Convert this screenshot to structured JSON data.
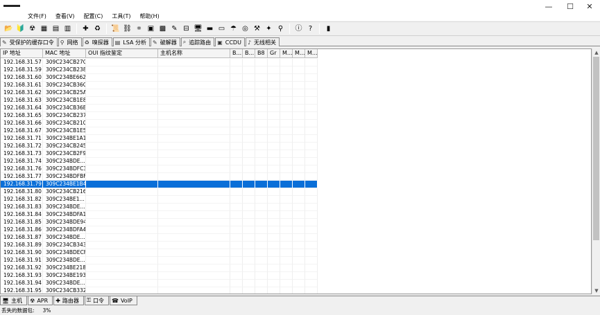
{
  "window": {
    "minimize": "—",
    "maximize": "☐",
    "close": "✕"
  },
  "menu": [
    "文件(F)",
    "查看(V)",
    "配置(C)",
    "工具(T)",
    "帮助(H)"
  ],
  "toolbar": {
    "groups": [
      [
        {
          "name": "open-icon",
          "glyph": "📂"
        },
        {
          "name": "sniffer-start-icon",
          "glyph": "🔰"
        },
        {
          "name": "radiation-icon",
          "glyph": "☢"
        },
        {
          "name": "scan-icon",
          "glyph": "▦"
        },
        {
          "name": "report-icon",
          "glyph": "▤"
        },
        {
          "name": "export-icon",
          "glyph": "▥"
        }
      ],
      [
        {
          "name": "add-icon",
          "glyph": "✚"
        },
        {
          "name": "recycle-icon",
          "glyph": "♻"
        }
      ],
      [
        {
          "name": "certificate-icon",
          "glyph": "📜"
        },
        {
          "name": "route-icon",
          "glyph": "⛓"
        },
        {
          "name": "hash-icon",
          "glyph": "⌗"
        },
        {
          "name": "terminal-green-icon",
          "glyph": "▣"
        },
        {
          "name": "matrix-icon",
          "glyph": "▩"
        },
        {
          "name": "torch-icon",
          "glyph": "✎"
        },
        {
          "name": "database-icon",
          "glyph": "⊟"
        },
        {
          "name": "monitor-icon",
          "glyph": "🖥"
        },
        {
          "name": "card-icon",
          "glyph": "▬"
        },
        {
          "name": "calculator-icon",
          "glyph": "▭"
        },
        {
          "name": "user-tool-icon",
          "glyph": "☂"
        },
        {
          "name": "ball-icon",
          "glyph": "◎"
        },
        {
          "name": "tools-icon",
          "glyph": "⚒"
        },
        {
          "name": "key-icon",
          "glyph": "✦"
        },
        {
          "name": "wand-icon",
          "glyph": "⚲"
        }
      ],
      [
        {
          "name": "info-icon",
          "glyph": "ⓘ"
        },
        {
          "name": "help-icon",
          "glyph": "?"
        }
      ],
      [
        {
          "name": "exit-icon",
          "glyph": "▮"
        }
      ]
    ]
  },
  "top_tabs": [
    {
      "label": "受保护的缓存口令",
      "icon": "shield-icon",
      "glyph": "✎"
    },
    {
      "label": "网络",
      "icon": "network-icon",
      "glyph": "⚲"
    },
    {
      "label": "嗅探器",
      "icon": "sniffer-icon",
      "glyph": "♻"
    },
    {
      "label": "LSA 分析",
      "icon": "lsa-icon",
      "glyph": "▤"
    },
    {
      "label": "破解器",
      "icon": "cracker-icon",
      "glyph": "✎"
    },
    {
      "label": "追踪路由",
      "icon": "traceroute-icon",
      "glyph": "⌕"
    },
    {
      "label": "CCDU",
      "icon": "ccdu-icon",
      "glyph": "▣"
    },
    {
      "label": "无线相关",
      "icon": "wireless-icon",
      "glyph": "♪"
    }
  ],
  "columns": [
    "IP 地址",
    "MAC 地址",
    "OUI 指纹鉴定",
    "主机名称",
    "B...",
    "B...",
    "B8",
    "Gr",
    "M...",
    "M...",
    "M..."
  ],
  "rows": [
    [
      "192.168.31.57",
      "309C234CB27C"
    ],
    [
      "192.168.31.59",
      "309C234CB238"
    ],
    [
      "192.168.31.60",
      "309C234BE662"
    ],
    [
      "192.168.31.61",
      "309C234CB36C"
    ],
    [
      "192.168.31.62",
      "309C234CB25A"
    ],
    [
      "192.168.31.63",
      "309C234CB1E8"
    ],
    [
      "192.168.31.64",
      "309C234CB36B"
    ],
    [
      "192.168.31.65",
      "309C234CB237"
    ],
    [
      "192.168.31.66",
      "309C234CB210"
    ],
    [
      "192.168.31.67",
      "309C234CB1E5"
    ],
    [
      "192.168.31.71",
      "309C234BE1A1"
    ],
    [
      "192.168.31.72",
      "309C234CB245"
    ],
    [
      "192.168.31.73",
      "309C234CB2F9"
    ],
    [
      "192.168.31.74",
      "309C234BDE..."
    ],
    [
      "192.168.31.76",
      "309C234BDFC3"
    ],
    [
      "192.168.31.77",
      "309C234BDFBF"
    ],
    [
      "192.168.31.79",
      "309C234BE1B4"
    ],
    [
      "192.168.31.80",
      "309C234CB216"
    ],
    [
      "192.168.31.82",
      "309C234BE1..."
    ],
    [
      "192.168.31.83",
      "309C234BDE..."
    ],
    [
      "192.168.31.84",
      "309C234BDFA1"
    ],
    [
      "192.168.31.85",
      "309C234BDE94"
    ],
    [
      "192.168.31.86",
      "309C234BDFA4"
    ],
    [
      "192.168.31.87",
      "309C234BDE..."
    ],
    [
      "192.168.31.89",
      "309C234CB343"
    ],
    [
      "192.168.31.90",
      "309C234BDECF"
    ],
    [
      "192.168.31.91",
      "309C234BDE..."
    ],
    [
      "192.168.31.92",
      "309C234BE218"
    ],
    [
      "192.168.31.93",
      "309C234BE193"
    ],
    [
      "192.168.31.94",
      "309C234BDE..."
    ],
    [
      "192.168.31.95",
      "309C234CB332"
    ]
  ],
  "selected_row_ip": "192.168.31.79",
  "bottom_tabs": [
    {
      "label": "主机",
      "icon": "host-icon",
      "glyph": "🖥"
    },
    {
      "label": "APR",
      "icon": "apr-icon",
      "glyph": "☢"
    },
    {
      "label": "路由器",
      "icon": "router-icon",
      "glyph": "✚"
    },
    {
      "label": "口令",
      "icon": "password-icon",
      "glyph": "⚿"
    },
    {
      "label": "VoIP",
      "icon": "voip-icon",
      "glyph": "☎"
    }
  ],
  "status": {
    "label": "丢失的数据包:",
    "value": "3%"
  },
  "colors": {
    "selection": "#0a6fd8"
  }
}
